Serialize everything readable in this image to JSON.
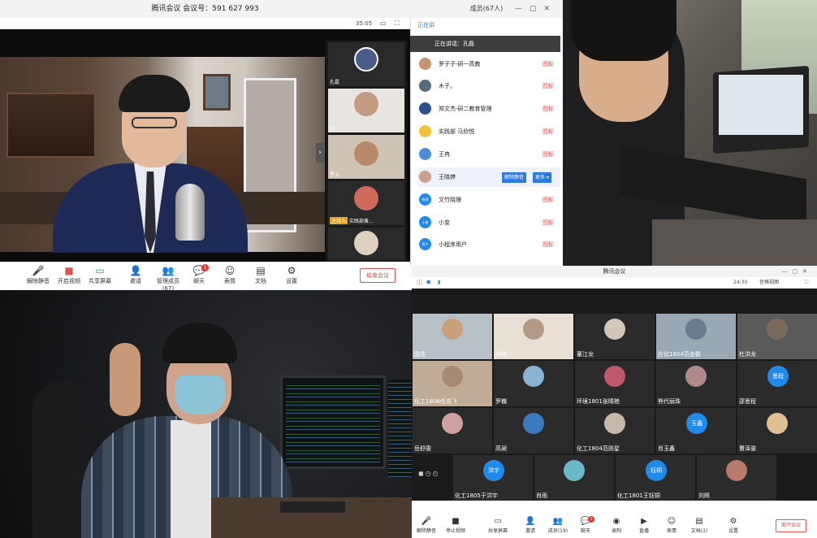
{
  "top_left": {
    "window_title": "腾讯会议 会议号：591 627 993",
    "timer": "35:05",
    "speaker_tiles": [
      {
        "name": "孔磊"
      },
      {
        "name": "Di"
      },
      {
        "name": "贾洁"
      },
      {
        "name": "实践部黄...",
        "tag": "主持人"
      },
      {
        "name": ""
      }
    ],
    "toolbar": {
      "mute": "解除静音",
      "video": "开启视频",
      "share": "共享屏幕",
      "invite": "邀请",
      "members": "管理成员(67)",
      "chat": "聊天",
      "chat_badge": "1",
      "reactions": "表情",
      "docs": "文档",
      "settings": "设置",
      "end": "结束会议"
    }
  },
  "members_panel": {
    "title": "成员(67人)",
    "speaking_now": "正在讲话：孔磊",
    "speaking_prefix": "正在讲",
    "mic_label": "图标",
    "members": [
      {
        "name": "罗子子-研一高教",
        "color": "#c9946a"
      },
      {
        "name": "木子。",
        "color": "#556a7c"
      },
      {
        "name": "郑文杰-研二教育管理",
        "color": "#2d4f8c"
      },
      {
        "name": "实践部 马欣悦",
        "color": "#f0c23a"
      },
      {
        "name": "王冉",
        "color": "#4a90d9"
      },
      {
        "name": "王晓婷",
        "color": "#caa08a",
        "actions": [
          "解除静音",
          "更多 ▾"
        ]
      },
      {
        "name": "文竹晓理",
        "color": "#1f8ceb",
        "initials": "晓理"
      },
      {
        "name": "小变",
        "color": "#1f8ceb",
        "initials": "小变"
      },
      {
        "name": "小程序用户",
        "color": "#1f8ceb",
        "initials": "用户"
      }
    ]
  },
  "bottom_right": {
    "window_title": "腾讯会议",
    "timer": "24:30",
    "view_mode": "宫格视图",
    "participants": [
      {
        "name": "国浩",
        "color": "#c9a07a"
      },
      {
        "name": "刘伟",
        "color": "#b39a84"
      },
      {
        "name": "董江龙",
        "color": "#d4c6b8"
      },
      {
        "name": "应化1804范金磊",
        "color": "#6b7a8c"
      },
      {
        "name": "杜洪龙",
        "color": "#7a6a5c"
      },
      {
        "name": "化工1808任浩飞",
        "color": "#a68a72"
      },
      {
        "name": "罗巍",
        "color": "#8ab3d4"
      },
      {
        "name": "环境1801张晴艳",
        "color": "#c05a6a"
      },
      {
        "name": "熊代丽珠",
        "color": "#b08a8a"
      },
      {
        "name": "邵思程",
        "initials": "思程"
      },
      {
        "name": "岳舒雯",
        "color": "#d0a0a0"
      },
      {
        "name": "高昶",
        "color": "#3a7ac0"
      },
      {
        "name": "化工1804范则星",
        "color": "#c8b8a8"
      },
      {
        "name": "肖玉鑫",
        "initials": "玉鑫"
      },
      {
        "name": "曹泽骏",
        "color": "#e0c090"
      },
      {
        "name": "化工1805于洪宇",
        "initials": "洪宇"
      },
      {
        "name": "肖雨",
        "color": "#6ab8c8"
      },
      {
        "name": "化工1801王钰铜",
        "initials": "钰铜"
      },
      {
        "name": "刘辉",
        "color": "#b87a6a"
      }
    ],
    "toolbar": {
      "mute": "解除静音",
      "video": "停止视频",
      "share": "共享屏幕",
      "invite": "邀请",
      "members": "成员(19)",
      "chat": "聊天",
      "chat_badge": "1",
      "record": "录制",
      "live": "直播",
      "reactions": "表情",
      "docs": "文档(1)",
      "settings": "设置",
      "leave": "离开会议"
    }
  }
}
